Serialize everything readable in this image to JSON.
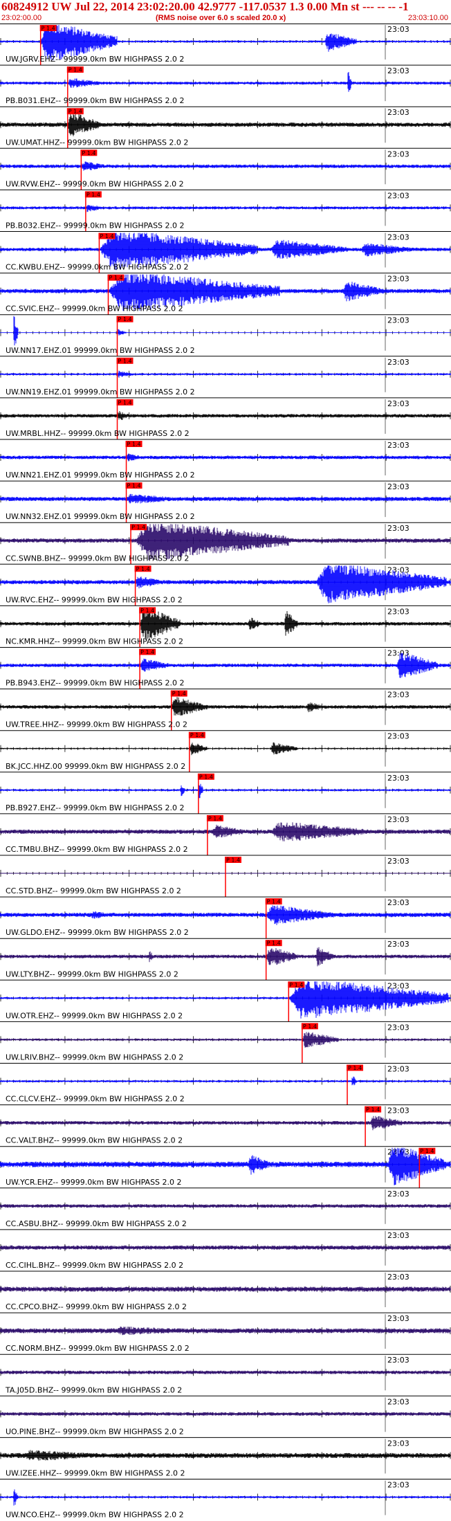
{
  "header": {
    "title": "60824912 UW Jul 22, 2014 23:02:20.00   42.9777 -117.0537  1.3 0.00 Mn st --- -- --   -1",
    "start_time": "23:02:00.00",
    "note": "(RMS noise over 6.0 s scaled 20.0 x)",
    "end_time": "23:03:10.00"
  },
  "tick_label": "23:03",
  "pick_label": "P 1.4",
  "colors": {
    "blue": "#0000ff",
    "black": "#000000",
    "purple": "#2a0a6a",
    "pick": "#ff0000",
    "bg": "#ffffff"
  },
  "traces": [
    {
      "label": "UW.JGRV.EHZ-- 99999.0km BW  HIGHPASS  2.0  2",
      "color": "blue",
      "pick": 0.09,
      "bursts": [
        [
          0.09,
          0.26,
          6
        ],
        [
          0.72,
          0.79,
          3
        ]
      ],
      "noise": 0.3
    },
    {
      "label": "PB.B031.EHZ-- 99999.0km BW  HIGHPASS  2.0  2",
      "color": "blue",
      "pick": 0.15,
      "bursts": [
        [
          0.15,
          0.23,
          1.5
        ],
        [
          0.77,
          0.78,
          4
        ]
      ],
      "noise": 0.4
    },
    {
      "label": "UW.UMAT.HHZ-- 99999.0km BW  HIGHPASS  2.0  2",
      "color": "black",
      "pick": 0.15,
      "bursts": [
        [
          0.15,
          0.22,
          4
        ]
      ],
      "noise": 0.6
    },
    {
      "label": "UW.RVW.EHZ-- 99999.0km BW  HIGHPASS  2.0  2",
      "color": "blue",
      "pick": 0.18,
      "bursts": [
        [
          0.18,
          0.24,
          1.5
        ]
      ],
      "noise": 0.5
    },
    {
      "label": "PB.B032.EHZ-- 99999.0km BW  HIGHPASS  2.0  2",
      "color": "blue",
      "pick": 0.19,
      "bursts": [
        [
          0.19,
          0.23,
          1.2
        ]
      ],
      "noise": 0.4
    },
    {
      "label": "CC.KWBU.EHZ-- 99999.0km BW  HIGHPASS  2.0  2",
      "color": "blue",
      "pick": 0.22,
      "bursts": [
        [
          0.22,
          0.57,
          6
        ],
        [
          0.6,
          0.77,
          3
        ],
        [
          0.8,
          0.92,
          2
        ]
      ],
      "noise": 0.5
    },
    {
      "label": "CC.SVIC.EHZ-- 99999.0km BW  HIGHPASS  2.0  2",
      "color": "blue",
      "pick": 0.24,
      "bursts": [
        [
          0.24,
          0.62,
          6
        ],
        [
          0.76,
          0.85,
          3
        ]
      ],
      "noise": 0.6
    },
    {
      "label": "UW.NN17.EHZ.01 99999.0km BW  HIGHPASS  2.0  2",
      "color": "blue",
      "pick": 0.26,
      "bursts": [
        [
          0.03,
          0.04,
          6
        ],
        [
          0.26,
          0.28,
          1.0
        ]
      ],
      "noise": 0.08
    },
    {
      "label": "UW.NN19.EHZ.01 99999.0km BW  HIGHPASS  2.0  2",
      "color": "blue",
      "pick": 0.26,
      "bursts": [
        [
          0.26,
          0.3,
          1.0
        ]
      ],
      "noise": 0.3
    },
    {
      "label": "UW.MRBL.HHZ-- 99999.0km BW  HIGHPASS  2.0  2",
      "color": "black",
      "pick": 0.26,
      "bursts": [
        [
          0.26,
          0.29,
          1.5
        ]
      ],
      "noise": 0.5
    },
    {
      "label": "UW.NN21.EHZ.01 99999.0km BW  HIGHPASS  2.0  2",
      "color": "blue",
      "pick": 0.28,
      "bursts": [
        [
          0.28,
          0.32,
          1.2
        ]
      ],
      "noise": 0.5
    },
    {
      "label": "UW.NN32.EHZ.01 99999.0km BW  HIGHPASS  2.0  2",
      "color": "blue",
      "pick": 0.28,
      "bursts": [
        [
          0.28,
          0.4,
          1.5
        ]
      ],
      "noise": 0.6
    },
    {
      "label": "CC.SWNB.BHZ-- 99999.0km BW  HIGHPASS  2.0  2",
      "color": "purple",
      "pick": 0.29,
      "bursts": [
        [
          0.3,
          0.64,
          6
        ]
      ],
      "noise": 0.6
    },
    {
      "label": "UW.RVC.EHZ-- 99999.0km BW  HIGHPASS  2.0  2",
      "color": "blue",
      "pick": 0.3,
      "bursts": [
        [
          0.3,
          0.36,
          2
        ],
        [
          0.7,
          0.99,
          6
        ]
      ],
      "noise": 0.6
    },
    {
      "label": "NC.KMR.HHZ-- 99999.0km BW  HIGHPASS  2.0  2",
      "color": "black",
      "pick": 0.31,
      "bursts": [
        [
          0.31,
          0.4,
          5
        ],
        [
          0.55,
          0.58,
          2
        ],
        [
          0.63,
          0.66,
          4
        ]
      ],
      "noise": 0.5
    },
    {
      "label": "PB.B943.EHZ-- 99999.0km BW  HIGHPASS  2.0  2",
      "color": "blue",
      "pick": 0.31,
      "bursts": [
        [
          0.31,
          0.38,
          2
        ],
        [
          0.88,
          0.97,
          4
        ]
      ],
      "noise": 0.5
    },
    {
      "label": "UW.TREE.HHZ-- 99999.0km BW  HIGHPASS  2.0  2",
      "color": "black",
      "pick": 0.38,
      "bursts": [
        [
          0.38,
          0.46,
          3
        ],
        [
          0.68,
          0.72,
          1.5
        ]
      ],
      "noise": 0.5
    },
    {
      "label": "BK.JCC.HHZ.00 99999.0km BW  HIGHPASS  2.0  2",
      "color": "black",
      "pick": 0.42,
      "bursts": [
        [
          0.42,
          0.46,
          2
        ],
        [
          0.6,
          0.66,
          1.8
        ]
      ],
      "noise": 0.2
    },
    {
      "label": "PB.B927.EHZ-- 99999.0km BW  HIGHPASS  2.0  2",
      "color": "blue",
      "pick": 0.44,
      "bursts": [
        [
          0.44,
          0.45,
          3
        ],
        [
          0.4,
          0.41,
          2
        ]
      ],
      "noise": 0.3
    },
    {
      "label": "CC.TMBU.BHZ-- 99999.0km BW  HIGHPASS  2.0  2",
      "color": "purple",
      "pick": 0.46,
      "bursts": [
        [
          0.47,
          0.55,
          2
        ],
        [
          0.6,
          0.82,
          3
        ]
      ],
      "noise": 0.6
    },
    {
      "label": "CC.STD.BHZ-- 99999.0km BW  HIGHPASS  2.0  2",
      "color": "purple",
      "pick": 0.5,
      "bursts": [],
      "noise": 0.06
    },
    {
      "label": "UW.GLDO.EHZ-- 99999.0km BW  HIGHPASS  2.0  2",
      "color": "blue",
      "pick": 0.59,
      "bursts": [
        [
          0.59,
          0.74,
          3
        ],
        [
          0.2,
          0.26,
          1.2
        ]
      ],
      "noise": 0.6
    },
    {
      "label": "UW.LTY.BHZ-- 99999.0km BW  HIGHPASS  2.0  2",
      "color": "purple",
      "pick": 0.59,
      "bursts": [
        [
          0.59,
          0.66,
          3
        ],
        [
          0.7,
          0.74,
          3
        ],
        [
          0.33,
          0.34,
          2
        ]
      ],
      "noise": 0.5
    },
    {
      "label": "UW.OTR.EHZ-- 99999.0km BW  HIGHPASS  2.0  2",
      "color": "blue",
      "pick": 0.64,
      "bursts": [
        [
          0.64,
          0.995,
          6
        ]
      ],
      "noise": 0.3
    },
    {
      "label": "UW.LRIV.BHZ-- 99999.0km BW  HIGHPASS  2.0  2",
      "color": "purple",
      "pick": 0.67,
      "bursts": [
        [
          0.67,
          0.75,
          2.5
        ]
      ],
      "noise": 0.3
    },
    {
      "label": "CC.CLCV.EHZ-- 99999.0km BW  HIGHPASS  2.0  2",
      "color": "blue",
      "pick": 0.77,
      "bursts": [
        [
          0.78,
          0.79,
          2
        ]
      ],
      "noise": 0.3
    },
    {
      "label": "CC.VALT.BHZ-- 99999.0km BW  HIGHPASS  2.0  2",
      "color": "purple",
      "pick": 0.81,
      "bursts": [
        [
          0.82,
          0.9,
          2.2
        ]
      ],
      "noise": 0.5
    },
    {
      "label": "UW.YCR.EHZ-- 99999.0km BW  HIGHPASS  2.0  2",
      "color": "blue",
      "pick": 0.93,
      "bursts": [
        [
          0.86,
          0.99,
          6
        ],
        [
          0.55,
          0.6,
          3
        ]
      ],
      "noise": 0.8
    },
    {
      "label": "CC.ASBU.BHZ-- 99999.0km BW  HIGHPASS  2.0  2",
      "color": "purple",
      "pick": null,
      "bursts": [],
      "noise": 0.5
    },
    {
      "label": "CC.CIHL.BHZ-- 99999.0km BW  HIGHPASS  2.0  2",
      "color": "purple",
      "pick": null,
      "bursts": [],
      "noise": 0.6
    },
    {
      "label": "CC.CPCO.BHZ-- 99999.0km BW  HIGHPASS  2.0  2",
      "color": "purple",
      "pick": null,
      "bursts": [],
      "noise": 0.7
    },
    {
      "label": "CC.NORM.BHZ-- 99999.0km BW  HIGHPASS  2.0  2",
      "color": "purple",
      "pick": null,
      "bursts": [
        [
          0.25,
          0.45,
          1.3
        ]
      ],
      "noise": 0.7
    },
    {
      "label": "TA.J05D.BHZ-- 99999.0km BW  HIGHPASS  2.0  2",
      "color": "purple",
      "pick": null,
      "bursts": [],
      "noise": 0.5
    },
    {
      "label": "UO.PINE.BHZ-- 99999.0km BW  HIGHPASS  2.0  2",
      "color": "purple",
      "pick": null,
      "bursts": [],
      "noise": 0.5
    },
    {
      "label": "UW.IZEE.HHZ-- 99999.0km BW  HIGHPASS  2.0  2",
      "color": "black",
      "pick": null,
      "bursts": [
        [
          0.05,
          0.25,
          1.6
        ]
      ],
      "noise": 0.7
    },
    {
      "label": "UW.NCO.EHZ-- 99999.0km BW  HIGHPASS  2.0  2",
      "color": "blue",
      "pick": null,
      "bursts": [
        [
          0.03,
          0.04,
          3
        ]
      ],
      "noise": 0.3
    }
  ]
}
